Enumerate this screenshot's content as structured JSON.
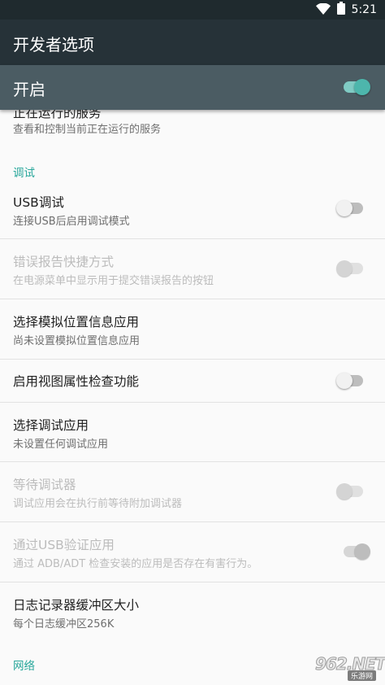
{
  "status_bar": {
    "time": "5:21",
    "wifi_icon": "wifi-icon",
    "battery_icon": "battery-icon"
  },
  "app_bar": {
    "title": "开发者选项"
  },
  "master_switch": {
    "label": "开启",
    "checked": true
  },
  "partial_item": {
    "title": "正在运行的服务",
    "summary": "查看和控制当前正在运行的服务"
  },
  "debug_category": "调试",
  "items": [
    {
      "title": "USB调试",
      "summary": "连接USB后启用调试模式",
      "has_switch": true,
      "checked": false,
      "enabled": true
    },
    {
      "title": "错误报告快捷方式",
      "summary": "在电源菜单中显示用于提交错误报告的按钮",
      "has_switch": true,
      "checked": false,
      "enabled": false
    },
    {
      "title": "选择模拟位置信息应用",
      "summary": "尚未设置模拟位置信息应用",
      "has_switch": false,
      "enabled": true
    },
    {
      "title": "启用视图属性检查功能",
      "summary": "",
      "has_switch": true,
      "checked": false,
      "enabled": true
    },
    {
      "title": "选择调试应用",
      "summary": "未设置任何调试应用",
      "has_switch": false,
      "enabled": true
    },
    {
      "title": "等待调试器",
      "summary": "调试应用会在执行前等待附加调试器",
      "has_switch": true,
      "checked": false,
      "enabled": false
    },
    {
      "title": "通过USB验证应用",
      "summary": "通过 ADB/ADT 检查安装的应用是否存在有害行为。",
      "has_switch": true,
      "checked": true,
      "enabled": false
    },
    {
      "title": "日志记录器缓冲区大小",
      "summary": "每个日志缓冲区256K",
      "has_switch": false,
      "enabled": true
    }
  ],
  "network_category": "网络",
  "watermark": {
    "logo": "962.NET",
    "sub": "乐游网"
  },
  "colors": {
    "app_bar": "#263238",
    "master_bar": "#4b5c63",
    "accent": "#26a69a",
    "switch_on": "#4db6ac"
  }
}
